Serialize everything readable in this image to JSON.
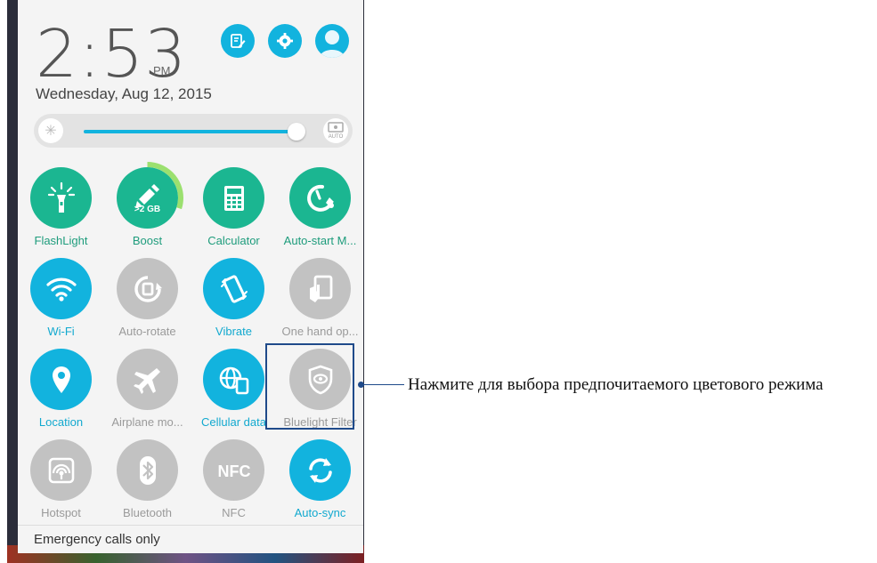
{
  "status": {
    "time": "2:53",
    "ampm": "PM",
    "date": "Wednesday, Aug 12, 2015"
  },
  "header_buttons": [
    {
      "icon": "edit-icon"
    },
    {
      "icon": "gear-icon"
    },
    {
      "icon": "avatar-icon"
    }
  ],
  "brightness": {
    "level": 0.97,
    "auto_label": "AUTO"
  },
  "tiles": [
    {
      "label": "FlashLight",
      "icon": "flashlight-icon",
      "state": "green"
    },
    {
      "label": "Boost",
      "icon": "boost-icon",
      "state": "green",
      "sub": ">2 GB",
      "progress": 0.3
    },
    {
      "label": "Calculator",
      "icon": "calculator-icon",
      "state": "green"
    },
    {
      "label": "Auto-start M...",
      "icon": "auto-start-icon",
      "state": "green"
    },
    {
      "label": "Wi-Fi",
      "icon": "wifi-icon",
      "state": "blue"
    },
    {
      "label": "Auto-rotate",
      "icon": "rotate-icon",
      "state": "gray"
    },
    {
      "label": "Vibrate",
      "icon": "vibrate-icon",
      "state": "blue"
    },
    {
      "label": "One hand op...",
      "icon": "one-hand-icon",
      "state": "gray"
    },
    {
      "label": "Location",
      "icon": "location-icon",
      "state": "blue"
    },
    {
      "label": "Airplane mo...",
      "icon": "airplane-icon",
      "state": "gray"
    },
    {
      "label": "Cellular data",
      "icon": "cellular-data-icon",
      "state": "blue"
    },
    {
      "label": "Bluelight Filter",
      "icon": "bluelight-filter-icon",
      "state": "gray"
    },
    {
      "label": "Hotspot",
      "icon": "hotspot-icon",
      "state": "gray"
    },
    {
      "label": "Bluetooth",
      "icon": "bluetooth-icon",
      "state": "gray"
    },
    {
      "label": "NFC",
      "icon": "nfc-icon",
      "state": "gray"
    },
    {
      "label": "Auto-sync",
      "icon": "sync-icon",
      "state": "blue"
    }
  ],
  "footer": {
    "emergency": "Emergency calls only"
  },
  "callout": {
    "text": "Нажмите для выбора предпочитаемого цветового режима"
  },
  "colors": {
    "accent_blue": "#12b3de",
    "accent_green": "#1bb691",
    "off_gray": "#c2c2c2",
    "callout": "#1f4a8a"
  }
}
